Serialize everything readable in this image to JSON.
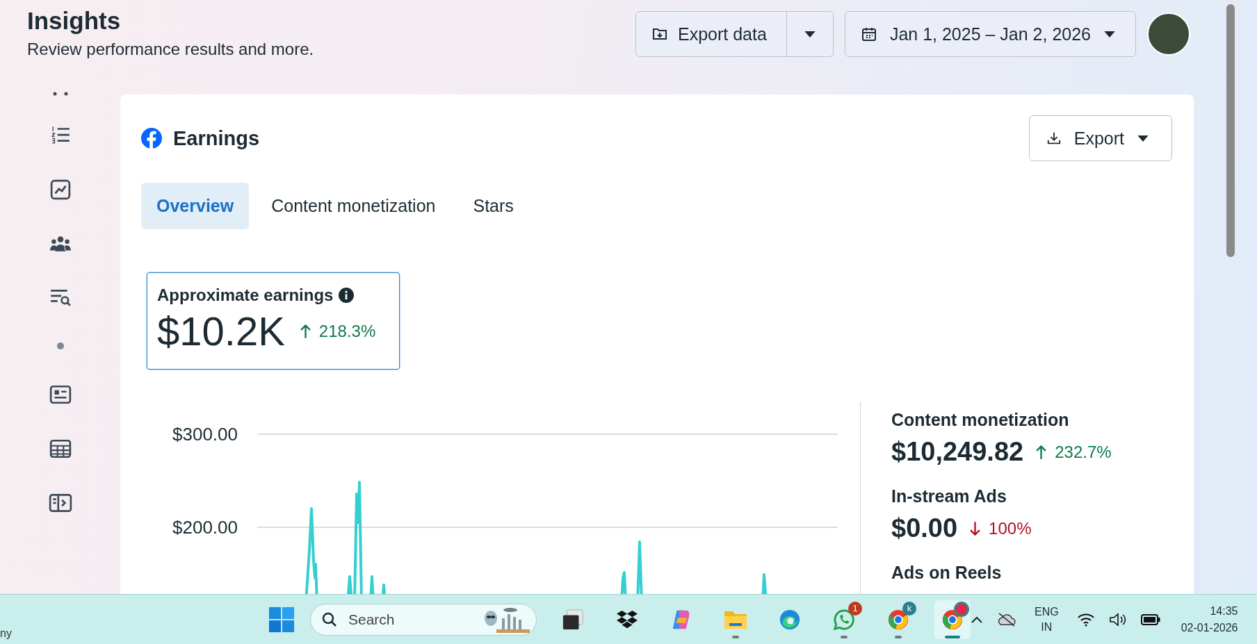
{
  "header": {
    "title": "Insights",
    "subtitle": "Review performance results and more."
  },
  "toolbar": {
    "export_data": "Export data",
    "date_range": "Jan 1, 2025 – Jan 2, 2026"
  },
  "card": {
    "title": "Earnings",
    "export": "Export",
    "tabs": [
      {
        "label": "Overview",
        "selected": true
      },
      {
        "label": "Content monetization",
        "selected": false
      },
      {
        "label": "Stars",
        "selected": false
      }
    ],
    "metric": {
      "title": "Approximate earnings",
      "value": "$10.2K",
      "change": "218.3%",
      "kind": "up",
      "selected": true
    },
    "chart": {
      "y_labels": [
        "$300.00",
        "$200.00"
      ]
    },
    "breakdown": [
      {
        "label": "Content monetization",
        "value": "$10,249.82",
        "change": "232.7%",
        "kind": "up"
      },
      {
        "label": "In-stream Ads",
        "value": "$0.00",
        "change": "100%",
        "kind": "down"
      },
      {
        "label": "Ads on Reels"
      }
    ]
  },
  "taskbar": {
    "left_text": "ny",
    "search_placeholder": "Search",
    "apps": [
      {
        "kind": "task-view",
        "running": false,
        "selected": false,
        "alert": false
      },
      {
        "kind": "dropbox",
        "running": false,
        "selected": false,
        "alert": false
      },
      {
        "kind": "copilot",
        "running": false,
        "selected": false,
        "alert": false
      },
      {
        "kind": "folder",
        "running": true,
        "selected": false,
        "alert": false
      },
      {
        "kind": "edge",
        "running": false,
        "selected": false,
        "alert": false
      },
      {
        "kind": "whatsapp",
        "badge": "1",
        "running": true,
        "selected": false,
        "alert": false
      },
      {
        "kind": "chrome",
        "badge": "k",
        "running": true,
        "selected": false,
        "alert": false
      },
      {
        "kind": "chrome",
        "running": true,
        "selected": true,
        "alert": true
      }
    ],
    "language": "ENG",
    "region": "IN",
    "time": "14:35",
    "date": "02-01-2026"
  }
}
